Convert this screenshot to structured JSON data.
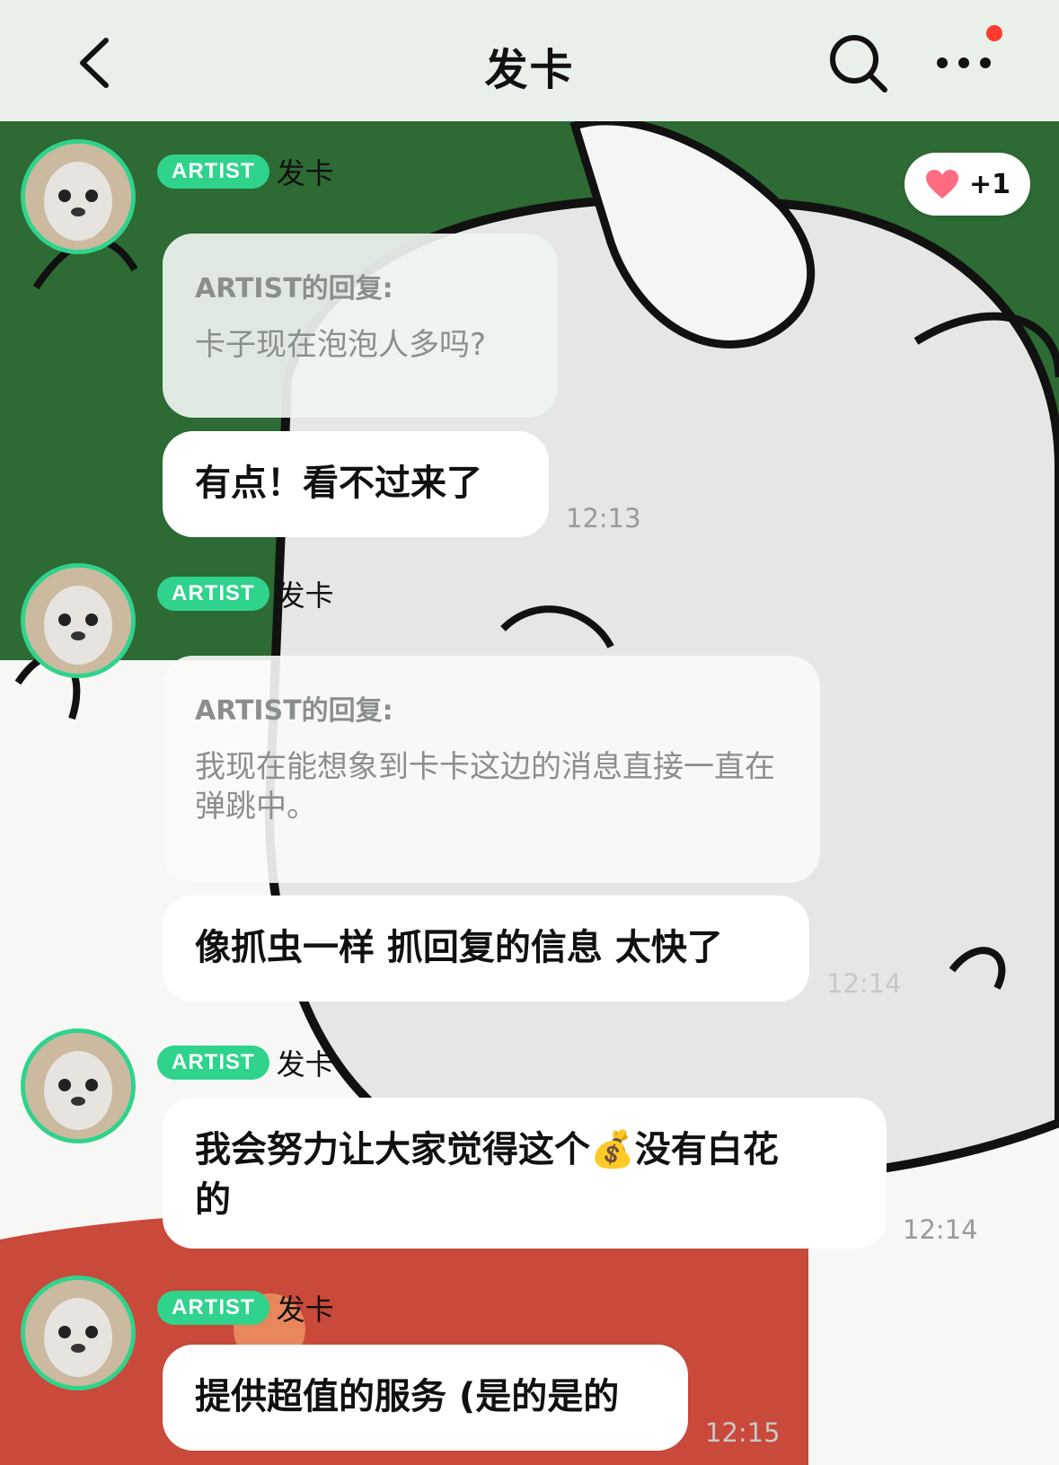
{
  "header": {
    "title": "发卡"
  },
  "reaction": {
    "count": "+1",
    "icon": "heart-icon",
    "color": "#ff6b81"
  },
  "accent_color": "#2fd38c",
  "messages": [
    {
      "badge": "ARTIST",
      "sender": "发卡",
      "reply_label": "ARTIST的回复:",
      "reply_text": "卡子现在泡泡人多吗?",
      "text": "有点！看不过来了",
      "time": "12:13"
    },
    {
      "badge": "ARTIST",
      "sender": "发卡",
      "reply_label": "ARTIST的回复:",
      "reply_text": "我现在能想象到卡卡这边的消息直接一直在弹跳中。",
      "text": "像抓虫一样 抓回复的信息 太快了",
      "time": "12:14"
    },
    {
      "badge": "ARTIST",
      "sender": "发卡",
      "text_line1": "我会努力让大家觉得这个💰没有白花",
      "text_line2": "的",
      "time": "12:14"
    },
    {
      "badge": "ARTIST",
      "sender": "发卡",
      "text": "提供超值的服务 (是的是的",
      "time": "12:15"
    }
  ]
}
